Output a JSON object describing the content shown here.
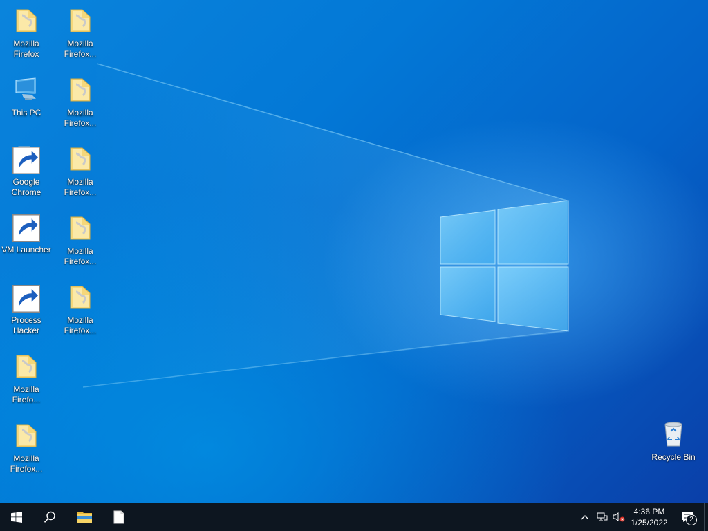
{
  "desktop": {
    "icons": [
      {
        "label": "Mozilla\nFirefox",
        "icon": "folder-icon"
      },
      {
        "label": "This PC",
        "icon": "this-pc-icon"
      },
      {
        "label": "Google\nChrome",
        "icon": "blank-file-shortcut-icon"
      },
      {
        "label": "VM Launcher",
        "icon": "virtualbox-shortcut-icon"
      },
      {
        "label": "Process\nHacker",
        "icon": "process-hacker-shortcut-icon"
      },
      {
        "label": "Mozilla\nFirefo...",
        "icon": "folder-icon"
      },
      {
        "label": "Mozilla\nFirefox...",
        "icon": "folder-icon"
      },
      {
        "label": "Mozilla\nFirefox...",
        "icon": "folder-icon"
      },
      {
        "label": "Mozilla\nFirefox...",
        "icon": "folder-icon"
      },
      {
        "label": "Mozilla\nFirefox...",
        "icon": "folder-icon"
      },
      {
        "label": "Mozilla\nFirefox...",
        "icon": "folder-icon"
      },
      {
        "label": "Mozilla\nFirefox...",
        "icon": "folder-icon"
      }
    ],
    "recycle_bin": {
      "label": "Recycle Bin",
      "icon": "recycle-bin-icon"
    }
  },
  "taskbar": {
    "start_icon": "windows-logo-icon",
    "search_icon": "search-icon",
    "pinned": [
      {
        "name": "file-explorer",
        "icon": "folder-icon"
      },
      {
        "name": "blank-document",
        "icon": "document-icon"
      }
    ],
    "tray": {
      "chevron_icon": "chevron-up-icon",
      "network_icon": "network-icon",
      "volume_icon": "volume-muted-icon",
      "time": "4:36 PM",
      "date": "1/25/2022",
      "notifications_count": "2"
    }
  },
  "colors": {
    "taskbar": "#0d1620",
    "wallpaper": "#0078d7",
    "folder": "#f5d77a"
  }
}
